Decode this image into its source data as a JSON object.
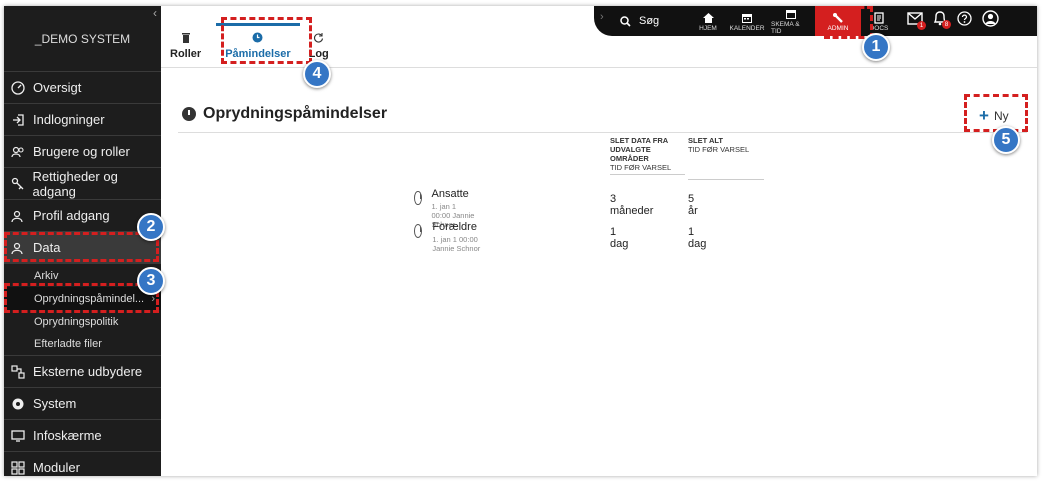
{
  "sidebar": {
    "brand": "_DEMO SYSTEM",
    "items": [
      {
        "label": "Oversigt",
        "icon": "dashboard-icon"
      },
      {
        "label": "Indlogninger",
        "icon": "login-icon"
      },
      {
        "label": "Brugere og roller",
        "icon": "users-icon"
      },
      {
        "label": "Rettigheder og adgang",
        "icon": "key-icon"
      },
      {
        "label": "Profil adgang",
        "icon": "profile-icon"
      },
      {
        "label": "Data",
        "icon": "data-icon"
      }
    ],
    "sub_items": [
      "Arkiv",
      "Oprydningspåmindel...",
      "Oprydningspolitik",
      "Efterladte filer"
    ],
    "items_after": [
      {
        "label": "Eksterne udbydere",
        "icon": "network-icon"
      },
      {
        "label": "System",
        "icon": "system-icon"
      },
      {
        "label": "Infoskærme",
        "icon": "screen-icon"
      },
      {
        "label": "Moduler",
        "icon": "modules-icon"
      }
    ]
  },
  "topbar": {
    "search_label": "Søg",
    "nav": [
      {
        "label": "HJEM"
      },
      {
        "label": "KALENDER"
      },
      {
        "label": "SKEMA & TID"
      },
      {
        "label": "ADMIN"
      },
      {
        "label": "DOCS"
      }
    ],
    "mail_badge": "1",
    "bell_badge": "8"
  },
  "tabs": [
    {
      "label": "Roller"
    },
    {
      "label": "Påmindelser"
    },
    {
      "label": "Log"
    }
  ],
  "page": {
    "title": "Oprydningspåmindelser",
    "new_label": "Ny"
  },
  "table": {
    "col1_head": [
      "SLET DATA FRA",
      "UDVALGTE",
      "OMRÅDER"
    ],
    "col1_sub": "TID FØR VARSEL",
    "col2_head": "SLET ALT",
    "col2_sub": "TID FØR VARSEL",
    "rows": [
      {
        "name": "Ansatte",
        "meta": "1. jan 1 00:00 Jannie Schnor",
        "v1": "3 måneder",
        "v2": "5 år"
      },
      {
        "name": "Forældre",
        "meta": "1. jan 1 00:00 Jannie Schnor",
        "v1": "1 dag",
        "v2": "1 dag"
      }
    ]
  },
  "annotations": [
    "1",
    "2",
    "3",
    "4",
    "5"
  ]
}
